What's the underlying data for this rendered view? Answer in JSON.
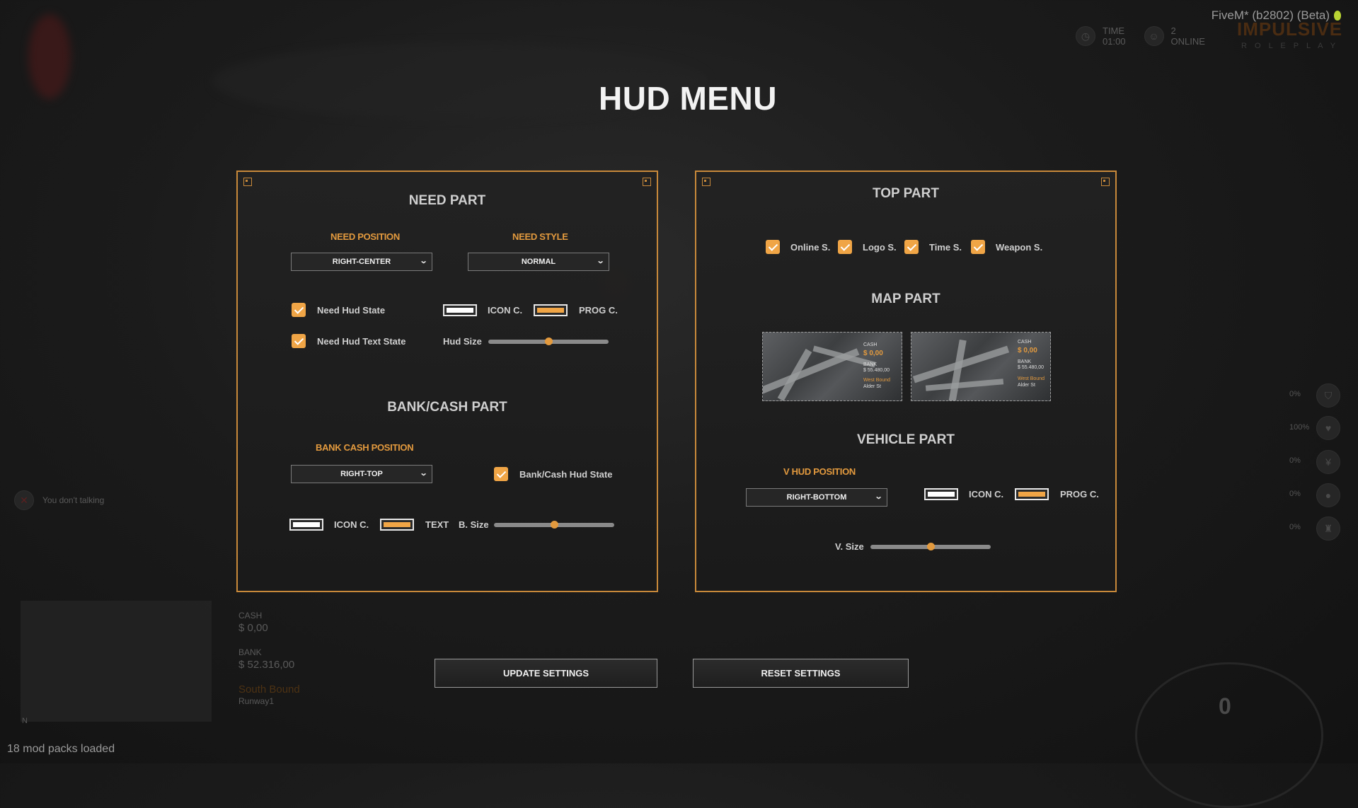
{
  "app": {
    "title": "FiveM* (b2802) (Beta)",
    "status_bottom": "18 mod packs loaded"
  },
  "menu": {
    "title": "HUD MENU"
  },
  "colors": {
    "accent": "#e39a3e",
    "icon_color": "#ffffff",
    "progress_color": "#f0a546"
  },
  "need_part": {
    "heading": "NEED PART",
    "position_label": "NEED POSITION",
    "position_value": "RIGHT-CENTER",
    "style_label": "NEED STYLE",
    "style_value": "NORMAL",
    "hud_state_label": "Need Hud State",
    "hud_state_checked": true,
    "text_state_label": "Need Hud Text State",
    "text_state_checked": true,
    "icon_color_label": "ICON C.",
    "prog_color_label": "PROG C.",
    "size_label": "Hud Size",
    "size_value": 0.5
  },
  "bank_part": {
    "heading": "BANK/CASH PART",
    "position_label": "BANK CASH POSITION",
    "position_value": "RIGHT-TOP",
    "state_label": "Bank/Cash Hud State",
    "state_checked": true,
    "icon_color_label": "ICON C.",
    "text_color_label": "TEXT",
    "size_label": "B. Size",
    "size_value": 0.5
  },
  "top_part": {
    "heading": "TOP PART",
    "toggles": [
      {
        "label": "Online S.",
        "checked": true
      },
      {
        "label": "Logo S.",
        "checked": true
      },
      {
        "label": "Time S.",
        "checked": true
      },
      {
        "label": "Weapon S.",
        "checked": true
      }
    ]
  },
  "map_part": {
    "heading": "MAP PART",
    "previews": [
      {
        "cash_label": "CASH",
        "cash": "$ 0,00",
        "bank_label": "BANK",
        "bank": "$ 55.480,00",
        "location": "West Bound",
        "street": "Alder St"
      },
      {
        "cash_label": "CASH",
        "cash": "$ 0,00",
        "bank_label": "BANK",
        "bank": "$ 55.480,00",
        "location": "West Bound",
        "street": "Alder St"
      }
    ]
  },
  "vehicle_part": {
    "heading": "VEHICLE PART",
    "position_label": "V HUD POSITION",
    "position_value": "RIGHT-BOTTOM",
    "icon_color_label": "ICON C.",
    "prog_color_label": "PROG C.",
    "size_label": "V. Size",
    "size_value": 0.5
  },
  "buttons": {
    "update": "UPDATE SETTINGS",
    "reset": "RESET SETTINGS"
  },
  "background_hud": {
    "time_label": "TIME",
    "time": "01:00",
    "online_count": "2",
    "online_label": "ONLINE",
    "logo_text": "IMPULSIVE",
    "logo_sub": "R O L E P L A Y",
    "voice": "You don't talking",
    "cash_label": "CASH",
    "cash": "$ 0,00",
    "bank_label": "BANK",
    "bank": "$ 52.316,00",
    "location": "South Bound",
    "street": "Runway1",
    "compass": "N",
    "speed": "0",
    "stats": [
      "0%",
      "100%",
      "0%",
      "0%",
      "0%"
    ]
  }
}
